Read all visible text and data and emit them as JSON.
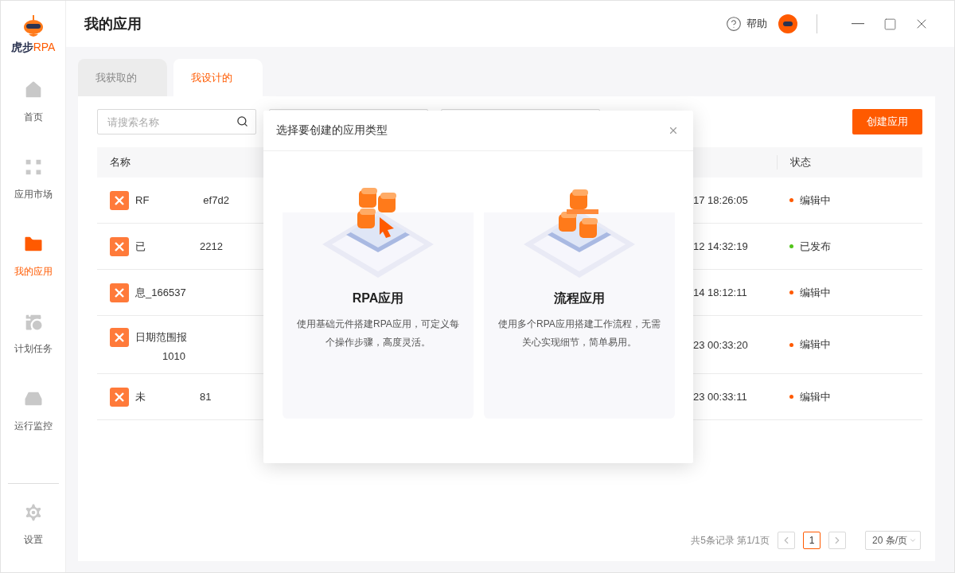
{
  "app": {
    "logo_text": "虎步",
    "logo_accent": "RPA"
  },
  "sidebar": {
    "items": [
      {
        "label": "首页",
        "selected": false
      },
      {
        "label": "应用市场",
        "selected": false
      },
      {
        "label": "我的应用",
        "selected": true
      },
      {
        "label": "计划任务",
        "selected": false
      },
      {
        "label": "运行监控",
        "selected": false
      }
    ],
    "footer": {
      "label": "设置"
    }
  },
  "header": {
    "title": "我的应用",
    "help": "帮助"
  },
  "tabs": [
    {
      "label": "我获取的",
      "selected": false
    },
    {
      "label": "我设计的",
      "selected": true
    }
  ],
  "search": {
    "placeholder": "请搜索名称"
  },
  "create_button": "创建应用",
  "table": {
    "columns": [
      "名称",
      "状态"
    ],
    "rows": [
      {
        "name_parts": [
          "RF",
          "ef7d2"
        ],
        "time": "17 18:26:05",
        "status": "编辑中",
        "color": "#ff5a00"
      },
      {
        "name_parts": [
          "已",
          "2212"
        ],
        "time": "12 14:32:19",
        "status": "已发布",
        "color": "#52c41a"
      },
      {
        "name_parts": [
          "息_166537"
        ],
        "time": "14 18:12:11",
        "status": "编辑中",
        "color": "#ff5a00"
      },
      {
        "name_parts": [
          "日期范围报"
        ],
        "second_line": "1010",
        "time": "23 00:33:20",
        "status": "编辑中",
        "color": "#ff5a00"
      },
      {
        "name_parts": [
          "未",
          "81"
        ],
        "time": "23 00:33:11",
        "status": "编辑中",
        "color": "#ff5a00"
      }
    ]
  },
  "pagination": {
    "summary": "共5条记录 第1/1页",
    "pages": [
      {
        "label": "1",
        "selected": true
      }
    ],
    "page_size": "20 条/页"
  },
  "dialog": {
    "title": "选择要创建的应用类型",
    "options": [
      {
        "kind": "rpa",
        "title": "RPA应用",
        "description": "使用基础元件搭建RPA应用，可定义每个操作步骤，高度灵活。"
      },
      {
        "kind": "flow",
        "title": "流程应用",
        "description": "使用多个RPA应用搭建工作流程，无需关心实现细节，简单易用。"
      }
    ]
  }
}
